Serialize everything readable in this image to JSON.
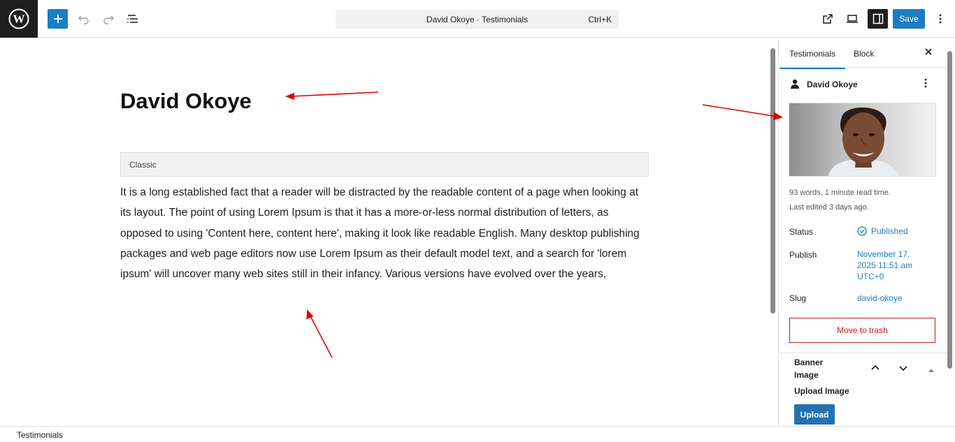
{
  "topbar": {
    "command_title": "David Okoye · Testimonials",
    "command_shortcut": "Ctrl+K",
    "save_label": "Save",
    "accent": "#1a7ec1"
  },
  "editor": {
    "post_title": "David Okoye",
    "classic_label": "Classic",
    "content": "It is a long established fact that a reader will be distracted by the readable content of a page when looking at its layout. The point of using Lorem Ipsum is that it has a more-or-less normal distribution of letters, as opposed to using 'Content here, content here', making it look like readable English. Many desktop publishing packages and web page editors now use Lorem Ipsum as their default model text, and a search for 'lorem ipsum' will uncover many web sites still in their infancy. Various versions have evolved over the years,"
  },
  "sidebar": {
    "tabs": [
      {
        "label": "Testimonials",
        "active": true
      },
      {
        "label": "Block",
        "active": false
      }
    ],
    "post_name": "David Okoye",
    "meta_line1": "93 words, 1 minute read time.",
    "meta_line2": "Last edited 3 days ago.",
    "status_label": "Status",
    "status_value": "Published",
    "publish_label": "Publish",
    "publish_line1": "November 17,",
    "publish_line2": "2025 11:51 am",
    "publish_line3": "UTC+0",
    "slug_label": "Slug",
    "slug_value": "david-okoye",
    "trash_label": "Move to trash",
    "banner_title": "Banner Image",
    "upload_label": "Upload Image",
    "upload_button": "Upload"
  },
  "footer": {
    "breadcrumb": "Testimonials"
  },
  "icons": [
    "wordpress-logo-icon",
    "plus-icon",
    "undo-icon",
    "redo-icon",
    "document-overview-icon",
    "external-link-icon",
    "desktop-preview-icon",
    "sidebar-toggle-icon",
    "more-vertical-icon",
    "close-icon",
    "person-icon",
    "published-check-icon",
    "chevron-up-icon",
    "chevron-down-icon",
    "triangle-up-icon"
  ]
}
